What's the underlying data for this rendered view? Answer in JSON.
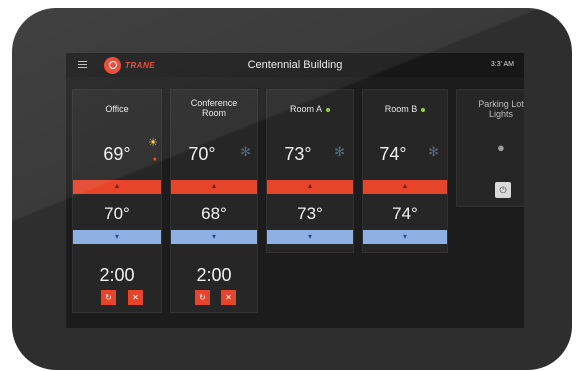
{
  "header": {
    "brand": "TRANE",
    "title": "Centennial Building",
    "time": "3:3' AM"
  },
  "zones": [
    {
      "name": "Office",
      "current": "69°",
      "setpoint": "70°",
      "timer": "2:00"
    },
    {
      "name": "Conference Room",
      "current": "70°",
      "setpoint": "68°",
      "timer": "2:00"
    },
    {
      "name": "Room A",
      "current": "73°",
      "setpoint": "73°"
    },
    {
      "name": "Room B",
      "current": "74°",
      "setpoint": "74°"
    }
  ],
  "parking": {
    "name": "Parking Lot Lights"
  },
  "icons": {
    "menu": "menu-icon",
    "snowflake": "snowflake-icon",
    "heat": "flame-icon",
    "light": "bulb-icon",
    "refresh": "refresh-icon",
    "cancel": "close-icon",
    "power": "power-icon",
    "up": "chevron-up-icon",
    "down": "chevron-down-icon"
  },
  "colors": {
    "accent": "#e6452c",
    "cool": "#8fb0e2",
    "status": "#9fd13c"
  }
}
